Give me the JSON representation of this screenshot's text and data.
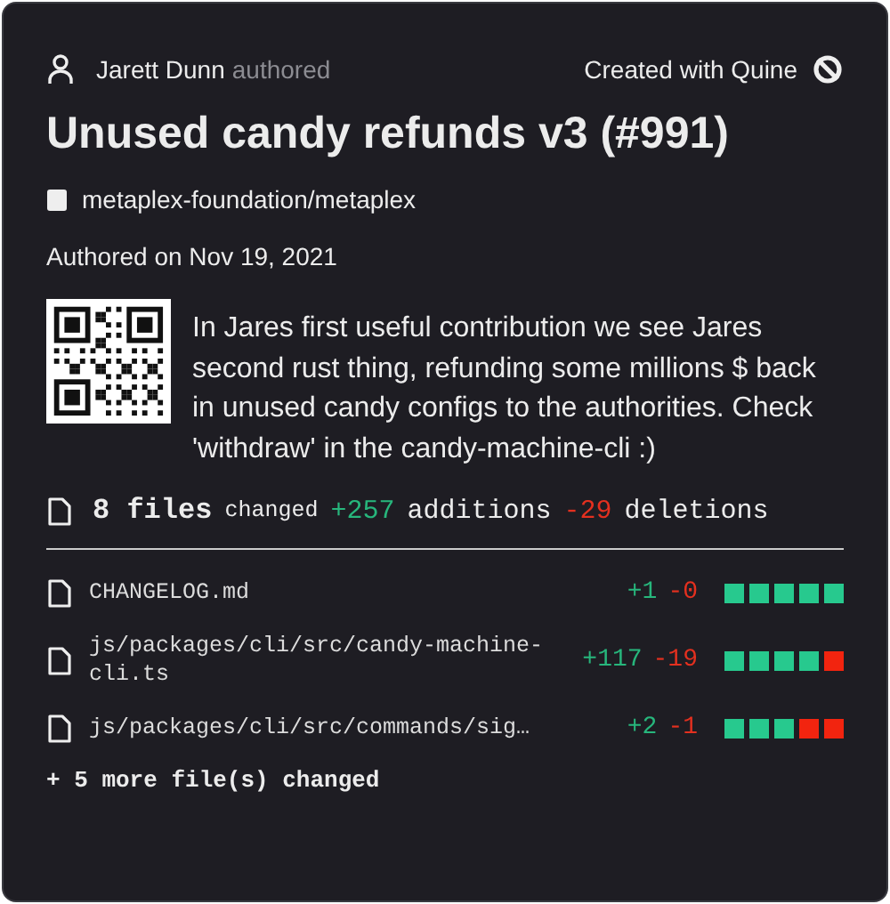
{
  "author": {
    "name": "Jarett Dunn",
    "action": "authored"
  },
  "credit": "Created with Quine",
  "title": "Unused candy refunds v3 (#991)",
  "repo": "metaplex-foundation/metaplex",
  "date": "Authored on Nov 19, 2021",
  "description": "In Jares first useful contribution we see Jares second rust thing, refunding some millions $ back in unused candy configs to the authorities. Check 'withdraw' in the candy-machine-cli :)",
  "summary": {
    "files": "8 files",
    "changed": "changed",
    "additions": "+257",
    "additions_label": "additions",
    "deletions": "-29",
    "deletions_label": "deletions"
  },
  "files": [
    {
      "name": "CHANGELOG.md",
      "additions": "+1",
      "deletions": "-0",
      "blocks": [
        {
          "kind": "added"
        },
        {
          "kind": "added"
        },
        {
          "kind": "added"
        },
        {
          "kind": "added"
        },
        {
          "kind": "added"
        }
      ]
    },
    {
      "name": "js/packages/cli/src/candy-machine-cli.ts",
      "additions": "+117",
      "deletions": "-19",
      "blocks": [
        {
          "kind": "added"
        },
        {
          "kind": "added"
        },
        {
          "kind": "added"
        },
        {
          "kind": "added"
        },
        {
          "kind": "deleted"
        }
      ]
    },
    {
      "name": "js/packages/cli/src/commands/sig…",
      "additions": "+2",
      "deletions": "-1",
      "blocks": [
        {
          "kind": "added"
        },
        {
          "kind": "added"
        },
        {
          "kind": "added"
        },
        {
          "kind": "deleted"
        },
        {
          "kind": "deleted"
        }
      ]
    }
  ],
  "more": "+ 5 more file(s) changed"
}
